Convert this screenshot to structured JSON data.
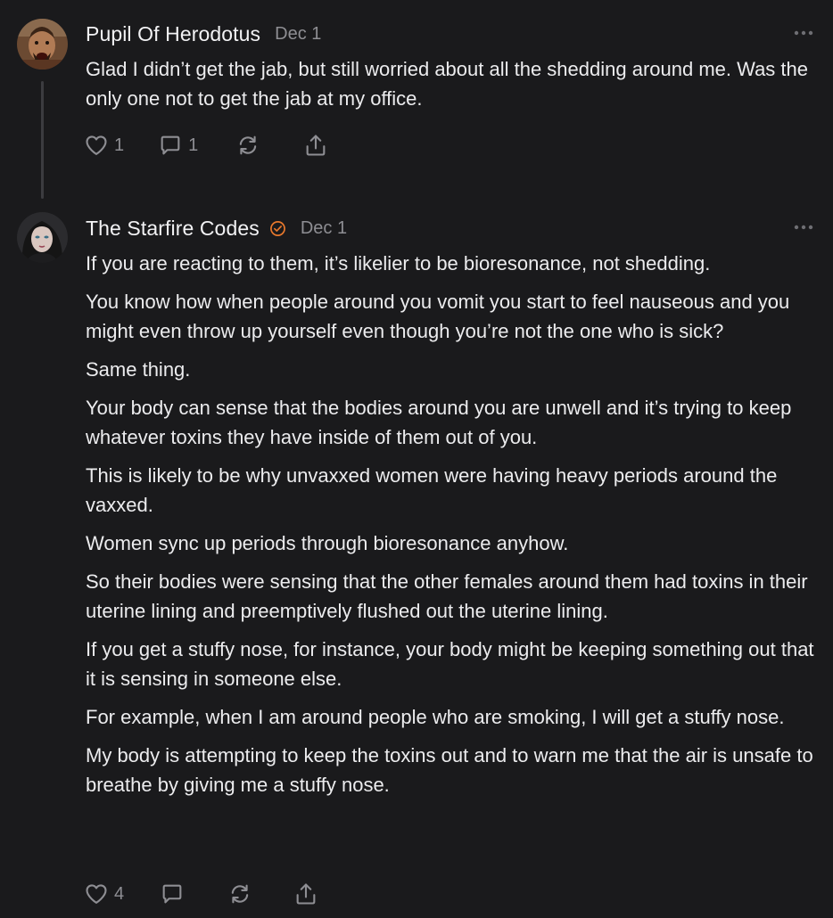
{
  "comments": [
    {
      "author": "Pupil Of Herodotus",
      "date": "Dec 1",
      "paragraphs": [
        "Glad I didn’t get the jab, but still worried about all the shedding around me. Was the only one not to get the jab at my office."
      ],
      "likes": "1",
      "replies": "1",
      "verified": false,
      "avatar_icon": "warrior-avatar"
    },
    {
      "author": "The Starfire Codes",
      "date": "Dec 1",
      "paragraphs": [
        "If you are reacting to them, it’s likelier to be bioresonance, not shedding.",
        "You know how when people around you vomit you start to feel nauseous and you might even throw up yourself even though you’re not the one who is sick?",
        "Same thing.",
        "Your body can sense that the bodies around you are unwell and it’s trying to keep whatever toxins they have inside of them out of you.",
        "This is likely to be why unvaxxed women were having heavy periods around the vaxxed.",
        "Women sync up periods through bioresonance anyhow.",
        "So their bodies were sensing that the other females around them had toxins in their uterine lining and preemptively flushed out the uterine lining.",
        "If you get a stuffy nose, for instance, your body might be keeping something out that it is sensing in someone else.",
        "For example, when I am around people who are smoking, I will get a stuffy nose.",
        "My body is attempting to keep the toxins out and to warn me that the air is unsafe to breathe by giving me a stuffy nose."
      ],
      "likes": "4",
      "replies": "",
      "verified": true,
      "avatar_icon": "woman-avatar"
    }
  ],
  "colors": {
    "background": "#1a1a1c",
    "text": "#ececee",
    "muted": "#8e8e93",
    "thread_line": "#3c3c40",
    "verified_badge": "#e8782c"
  },
  "icons": {
    "like": "heart-icon",
    "reply": "comment-bubble-icon",
    "restack": "restack-icon",
    "share": "share-icon",
    "more": "more-options-icon",
    "verified": "verified-badge-icon"
  }
}
